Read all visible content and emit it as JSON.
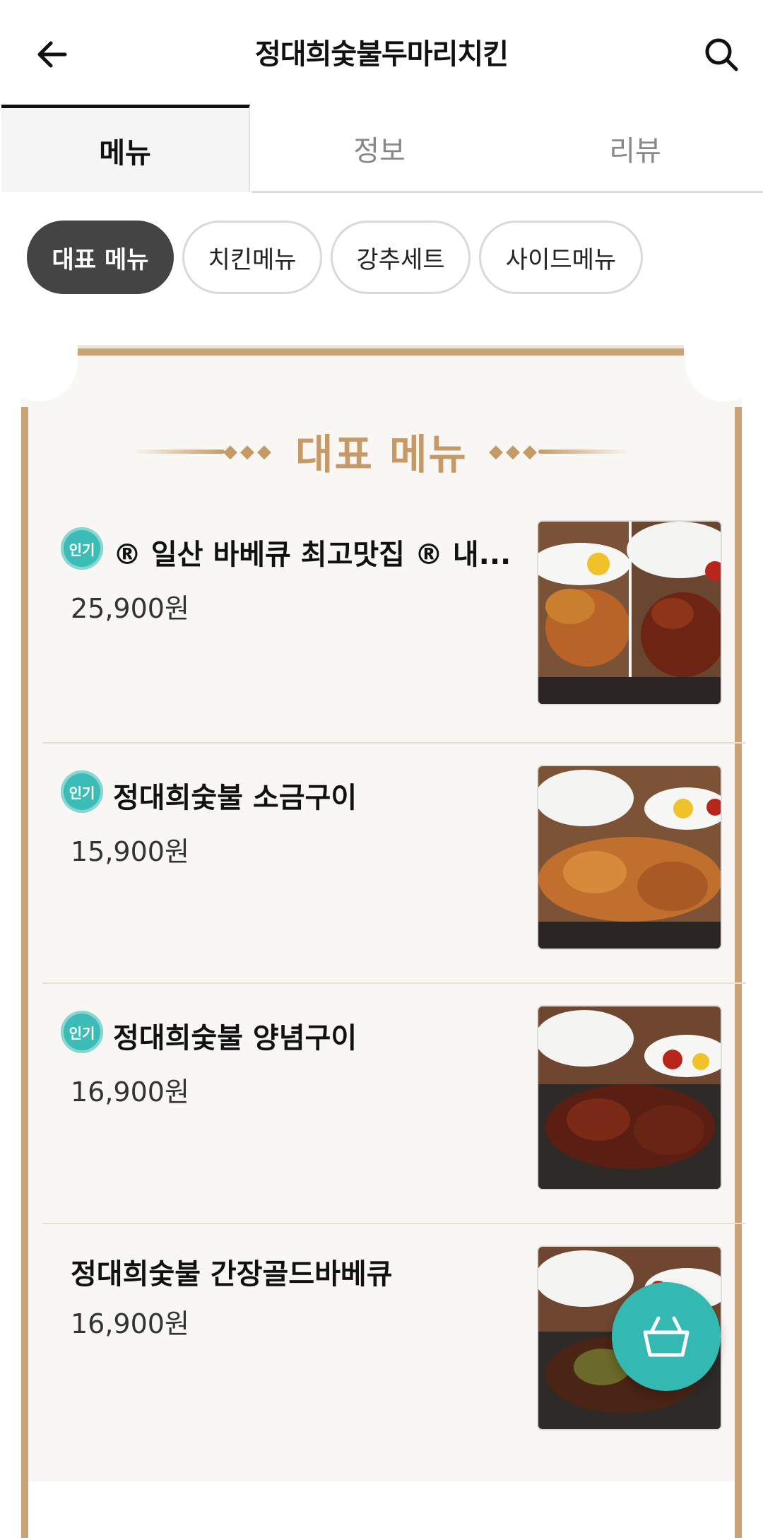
{
  "header": {
    "title": "정대희숯불두마리치킨"
  },
  "tabs": [
    {
      "label": "메뉴",
      "active": true
    },
    {
      "label": "정보",
      "active": false
    },
    {
      "label": "리뷰",
      "active": false
    }
  ],
  "chips": [
    {
      "label": "대표 메뉴",
      "active": true
    },
    {
      "label": "치킨메뉴",
      "active": false
    },
    {
      "label": "강추세트",
      "active": false
    },
    {
      "label": "사이드메뉴",
      "active": false
    }
  ],
  "section": {
    "title": "대표 메뉴"
  },
  "items": [
    {
      "badge": "인기",
      "name": "® 일산 바베큐 최고맛집 ® 내...",
      "price": "25,900원"
    },
    {
      "badge": "인기",
      "name": "정대희숯불 소금구이",
      "price": "15,900원"
    },
    {
      "badge": "인기",
      "name": "정대희숯불 양념구이",
      "price": "16,900원"
    },
    {
      "badge": "",
      "name": "정대희숯불 간장골드바베큐",
      "price": "16,900원"
    }
  ],
  "colors": {
    "accent": "#34b9b2",
    "gold": "#c69a66",
    "active_chip": "#444444"
  },
  "icons": {
    "back": "arrow-left-icon",
    "search": "search-icon",
    "cart": "basket-icon"
  }
}
